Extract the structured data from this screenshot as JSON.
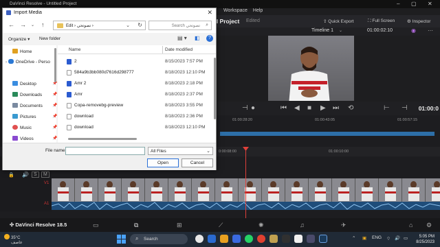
{
  "resolve": {
    "window_title": "DaVinci Resolve - Untitled Project",
    "menu": [
      "Workspace",
      "Help"
    ],
    "project_title": "d Project",
    "project_status": "Edited",
    "quick_export": "Quick Export",
    "full_screen": "Full Screen",
    "inspector": "Inspector",
    "timeline_name": "Timeline 1",
    "viewer_timecode": "01:00:02:10",
    "playback_timecode": "01:00:0",
    "ruler_top": [
      "01:00:28:20",
      "01:00:43:05",
      "01:00:57:15"
    ],
    "ruler_main": [
      "0:00:08:00",
      "01:00:10:00"
    ],
    "track_v1": "V1",
    "track_a1": "A1",
    "brand": "DaVinci Resolve 18.5"
  },
  "dialog": {
    "title": "Import Media",
    "path_root": "Edit",
    "path_folder": "تصوتحي",
    "search_placeholder": "Search تصوتحي",
    "organize": "Organize",
    "new_folder": "New folder",
    "sidebar": [
      {
        "label": "Home",
        "icon": "home-icon",
        "color": "#e0a020"
      },
      {
        "label": "OneDrive - Perso",
        "icon": "cloud-icon",
        "color": "#2a78d4"
      },
      {
        "label": "Desktop",
        "icon": "desktop-icon",
        "color": "#3a8de0"
      },
      {
        "label": "Downloads",
        "icon": "download-icon",
        "color": "#2a8a5a"
      },
      {
        "label": "Documents",
        "icon": "documents-icon",
        "color": "#7a8aa0"
      },
      {
        "label": "Pictures",
        "icon": "pictures-icon",
        "color": "#3a9ad0"
      },
      {
        "label": "Music",
        "icon": "music-icon",
        "color": "#e05050"
      },
      {
        "label": "Videos",
        "icon": "videos-icon",
        "color": "#8a4ad0"
      }
    ],
    "columns": {
      "name": "Name",
      "date": "Date modified"
    },
    "files": [
      {
        "name": "2",
        "date": "8/15/2023 7:57 PM",
        "type": "video"
      },
      {
        "name": "584a9b3bb080d7616d298777",
        "date": "8/18/2023 12:10 PM",
        "type": "plain"
      },
      {
        "name": "Amr 2",
        "date": "8/18/2023 2:18 PM",
        "type": "video"
      },
      {
        "name": "Amr",
        "date": "8/18/2023 2:37 PM",
        "type": "video"
      },
      {
        "name": "Copa-removebg-preview",
        "date": "8/18/2023 3:55 PM",
        "type": "plain"
      },
      {
        "name": "download",
        "date": "8/18/2023 2:36 PM",
        "type": "plain"
      },
      {
        "name": "download",
        "date": "8/18/2023 12:10 PM",
        "type": "plain"
      }
    ],
    "file_name_label": "File name:",
    "file_name_value": "",
    "file_type": "All Files",
    "open_button": "Open",
    "cancel_button": "Cancel"
  },
  "taskbar": {
    "temperature": "35°C",
    "weather_text": "عاصف",
    "search": "Search",
    "language": "ENG",
    "time": "5:05 PM",
    "date": "8/25/2023"
  }
}
